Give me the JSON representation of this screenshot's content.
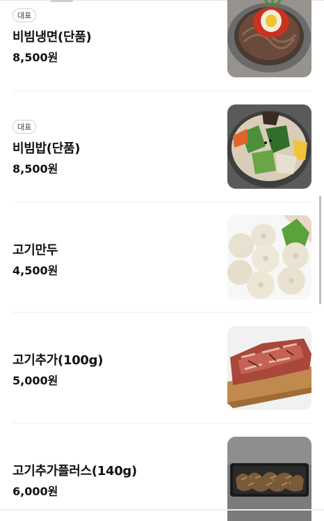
{
  "menu": {
    "items": [
      {
        "badge": "대표",
        "name": "비빔냉면(단품)",
        "price": "8,500원",
        "image_icon": "bibim-naengmyeon-image"
      },
      {
        "badge": "대표",
        "name": "비빔밥(단품)",
        "price": "8,500원",
        "image_icon": "bibimbap-image"
      },
      {
        "name": "고기만두",
        "price": "4,500원",
        "image_icon": "meat-dumpling-image"
      },
      {
        "name": "고기추가(100g)",
        "price": "5,000원",
        "image_icon": "extra-meat-image"
      },
      {
        "name": "고기추가플러스(140g)",
        "price": "6,000원",
        "image_icon": "extra-meat-plus-image"
      }
    ]
  },
  "colors": {
    "badge_border": "#cfcfcf",
    "divider": "#eeeeee",
    "text": "#111111",
    "scrollbar": "#bdbdbd"
  }
}
